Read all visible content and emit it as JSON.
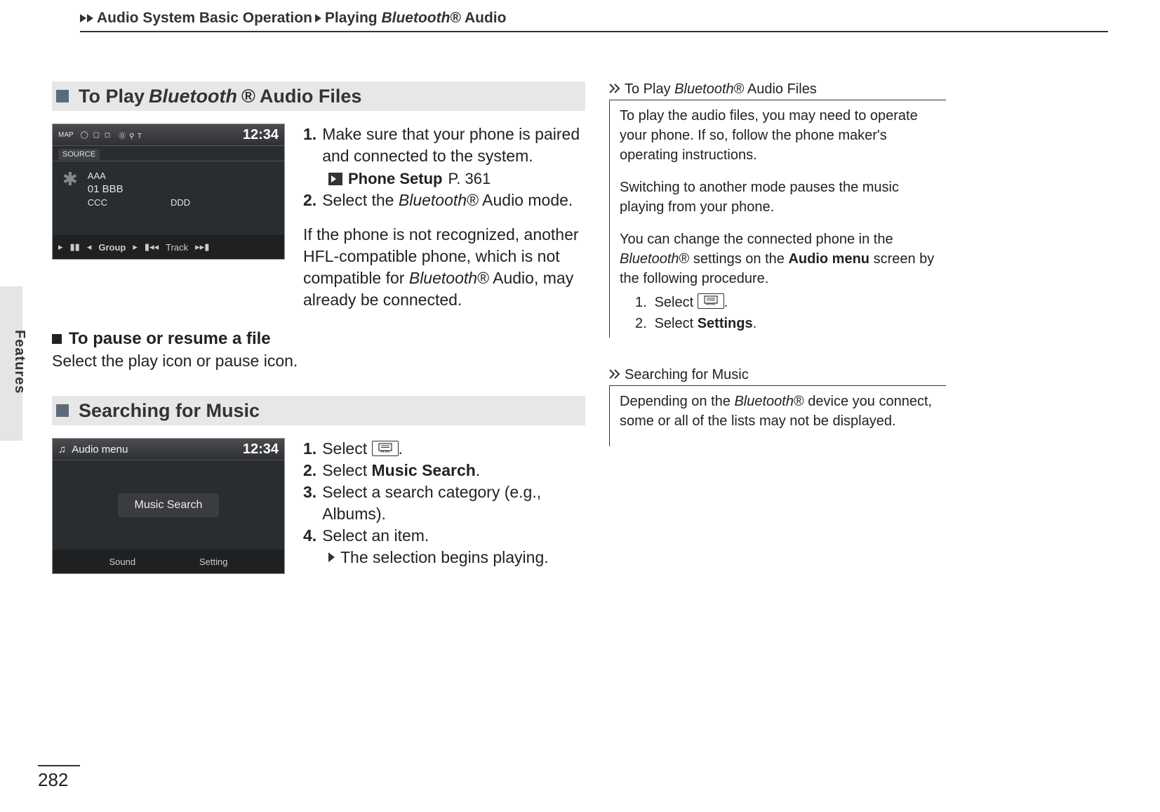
{
  "header": {
    "breadcrumb": [
      "Audio System Basic Operation",
      "Playing ",
      "Bluetooth",
      "®",
      " Audio"
    ]
  },
  "side_tab": "Features",
  "page_number": "282",
  "section1": {
    "title_parts": [
      "To Play ",
      "Bluetooth",
      "®",
      " Audio Files"
    ],
    "shot": {
      "top_left": "MAP",
      "source_btn": "SOURCE",
      "icons_mid": "◯ ▢ ◻",
      "icons_right": "⓪ ⚲ T",
      "clock": "12:34",
      "line1": "AAA",
      "line2": "01 BBB",
      "line3_left": "CCC",
      "line3_right": "DDD",
      "group_label": "Group",
      "track_label": "Track"
    },
    "steps": {
      "s1_num": "1.",
      "s1_a": "Make sure that your phone is paired and connected to the system.",
      "s1_xref_label": "Phone Setup",
      "s1_xref_page": "P. 361",
      "s2_num": "2.",
      "s2_pre": "Select the ",
      "s2_bt": "Bluetooth",
      "s2_reg": "®",
      "s2_post": " Audio mode.",
      "note_pre": "If the phone is not recognized, another HFL-compatible phone, which is not compatible for ",
      "note_bt": "Bluetooth",
      "note_reg": "®",
      "note_post": " Audio, may already be connected."
    },
    "sub_title": "To pause or resume a file",
    "sub_text": "Select the play icon or pause icon."
  },
  "section2": {
    "title": "Searching for Music",
    "shot": {
      "audio_menu": "Audio menu",
      "clock": "12:34",
      "center": "Music Search",
      "btn_left": "Sound",
      "btn_right": "Setting"
    },
    "steps": {
      "s1_num": "1.",
      "s1_a": "Select ",
      "s1_b": ".",
      "s2_num": "2.",
      "s2_a": "Select ",
      "s2_b": "Music Search",
      "s2_c": ".",
      "s3_num": "3.",
      "s3_a": "Select a search category (e.g., Albums).",
      "s4_num": "4.",
      "s4_a": "Select an item.",
      "s4_sub": "The selection begins playing."
    }
  },
  "sidebar": {
    "block1": {
      "title_parts": [
        "To Play ",
        "Bluetooth",
        "®",
        " Audio Files"
      ],
      "p1": "To play the audio files, you may need to operate your phone. If so, follow the phone maker's operating instructions.",
      "p2": "Switching to another mode pauses the music playing from your phone.",
      "p3_pre": "You can change the connected phone in the ",
      "p3_bt": "Bluetooth",
      "p3_reg": "®",
      "p3_mid": " settings on the ",
      "p3_bold": "Audio menu",
      "p3_post": " screen by the following procedure.",
      "li1_a": "Select ",
      "li1_end": ".",
      "li2_a": "Select ",
      "li2_b": "Settings",
      "li2_end": "."
    },
    "block2": {
      "title": "Searching for Music",
      "p1_pre": "Depending on the ",
      "p1_bt": "Bluetooth",
      "p1_reg": "®",
      "p1_post": " device you connect, some or all of the lists may not be displayed."
    }
  }
}
